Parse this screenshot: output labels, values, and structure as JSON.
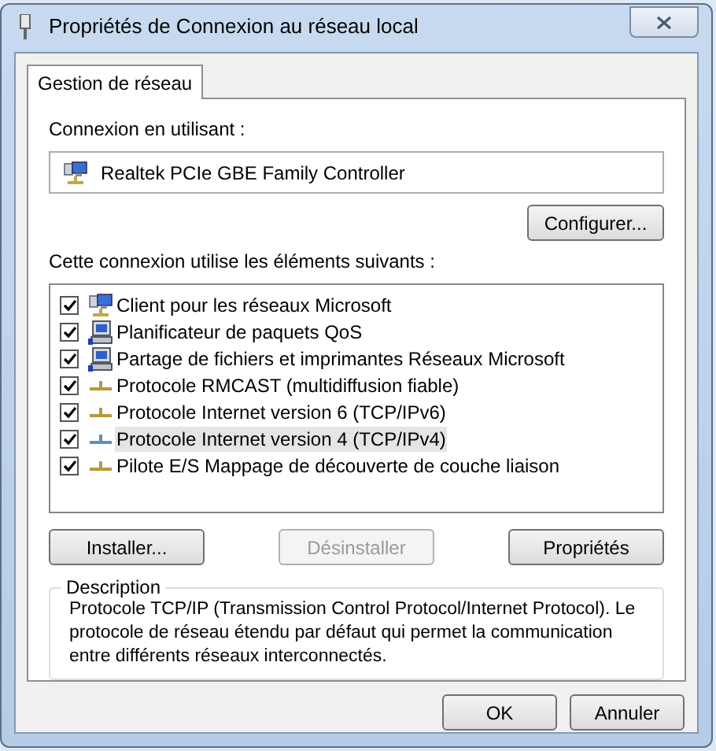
{
  "window": {
    "title": "Propriétés de Connexion au réseau local"
  },
  "tabs": [
    {
      "label": "Gestion de réseau",
      "selected": true
    }
  ],
  "connection": {
    "label": "Connexion en utilisant :",
    "adapter": "Realtek PCIe GBE Family Controller",
    "configure_button": "Configurer..."
  },
  "components": {
    "label": "Cette connexion utilise les éléments suivants :",
    "items": [
      {
        "kind": "client",
        "label": "Client pour les réseaux Microsoft",
        "checked": true,
        "selected": false
      },
      {
        "kind": "service",
        "label": "Planificateur de paquets QoS",
        "checked": true,
        "selected": false
      },
      {
        "kind": "service",
        "label": "Partage de fichiers et imprimantes Réseaux Microsoft",
        "checked": true,
        "selected": false
      },
      {
        "kind": "protocol",
        "label": "Protocole RMCAST (multidiffusion fiable)",
        "checked": true,
        "selected": false
      },
      {
        "kind": "protocol",
        "label": "Protocole Internet version 6 (TCP/IPv6)",
        "checked": true,
        "selected": false
      },
      {
        "kind": "protocol",
        "label": "Protocole Internet version 4 (TCP/IPv4)",
        "checked": true,
        "selected": true
      },
      {
        "kind": "protocol",
        "label": "Pilote E/S Mappage de découverte de couche liaison",
        "checked": true,
        "selected": false
      }
    ]
  },
  "actions": [
    {
      "label": "Installer...",
      "disabled": false
    },
    {
      "label": "Désinstaller",
      "disabled": true
    },
    {
      "label": "Propriétés",
      "disabled": false
    }
  ],
  "description": {
    "title": "Description",
    "text": "Protocole TCP/IP (Transmission Control Protocol/Internet Protocol). Le protocole de réseau étendu par défaut qui permet la communication entre différents réseaux interconnectés."
  },
  "buttons": [
    "OK",
    "Annuler"
  ]
}
